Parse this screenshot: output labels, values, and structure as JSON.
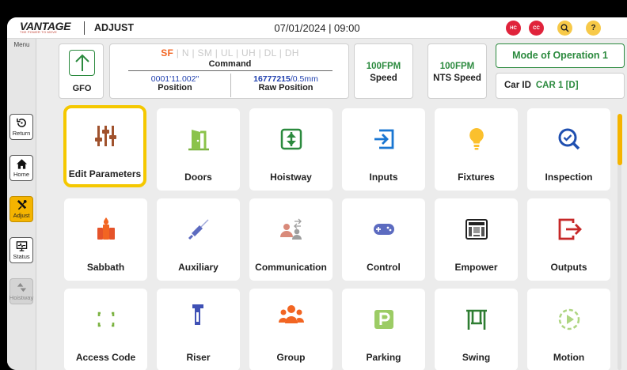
{
  "header": {
    "logo": "VANTAGE",
    "logo_tagline": "THE POWER TO MOVE",
    "title": "ADJUST",
    "datetime": "07/01/2024 | 09:00",
    "hc_badge": "HC",
    "cc_badge": "CC",
    "help": "?"
  },
  "nav": {
    "menu_label": "Menu",
    "items": [
      {
        "label": "Return",
        "icon": "return-icon",
        "state": "normal"
      },
      {
        "label": "Home",
        "icon": "home-icon",
        "state": "normal"
      },
      {
        "label": "Adjust",
        "icon": "tools-icon",
        "state": "active"
      },
      {
        "label": "Status",
        "icon": "monitor-icon",
        "state": "normal"
      },
      {
        "label": "Hoistway",
        "icon": "updown-icon",
        "state": "disabled"
      }
    ]
  },
  "status": {
    "gfo_label": "GFO",
    "floors": [
      "SF",
      "N",
      "SM",
      "UL",
      "UH",
      "DL",
      "DH"
    ],
    "floor_sep": " | ",
    "current_floor": "SF",
    "command_label": "Command",
    "position_value": "0001'11.002\"",
    "position_label": "Position",
    "raw_position_value": "16777215",
    "raw_position_unit": "/0.5mm",
    "raw_position_label": "Raw Position",
    "speed_value": "100FPM",
    "speed_label": "Speed",
    "nts_speed_value": "100FPM",
    "nts_speed_label": "NTS Speed",
    "mode": "Mode of Operation 1",
    "car_id_label": "Car ID",
    "car_id_value": "CAR 1 [D]"
  },
  "tiles": [
    {
      "label": "Edit Parameters",
      "icon": "sliders-icon",
      "selected": true
    },
    {
      "label": "Doors",
      "icon": "door-icon"
    },
    {
      "label": "Hoistway",
      "icon": "hoistway-icon"
    },
    {
      "label": "Inputs",
      "icon": "input-icon"
    },
    {
      "label": "Fixtures",
      "icon": "bulb-icon"
    },
    {
      "label": "Inspection",
      "icon": "magnifier-icon"
    },
    {
      "label": "Sabbath",
      "icon": "candle-icon"
    },
    {
      "label": "Auxiliary",
      "icon": "cable-icon"
    },
    {
      "label": "Communication",
      "icon": "users-exchange-icon"
    },
    {
      "label": "Control",
      "icon": "gamepad-icon"
    },
    {
      "label": "Empower",
      "icon": "controller-box-icon"
    },
    {
      "label": "Outputs",
      "icon": "output-icon"
    },
    {
      "label": "Access Code",
      "icon": "corners-icon"
    },
    {
      "label": "Riser",
      "icon": "riser-icon"
    },
    {
      "label": "Group",
      "icon": "group-icon"
    },
    {
      "label": "Parking",
      "icon": "parking-icon"
    },
    {
      "label": "Swing",
      "icon": "swing-icon"
    },
    {
      "label": "Motion",
      "icon": "play-dashed-icon"
    }
  ],
  "colors": {
    "accent": "#f5c800",
    "green": "#2b8a3e",
    "blue": "#1f3fae",
    "floor_active": "#f26522",
    "badge_red": "#e0233b"
  }
}
